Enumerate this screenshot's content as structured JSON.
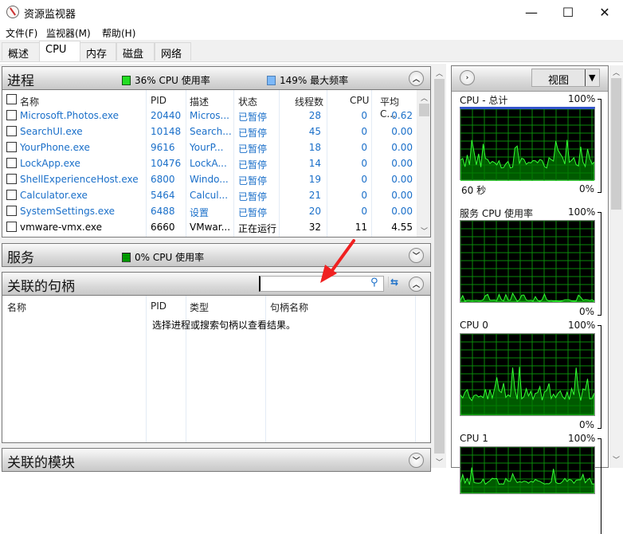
{
  "window": {
    "title": "资源监视器",
    "icon": "resource-monitor-icon",
    "controls": {
      "minimize": "—",
      "maximize": "☐",
      "close": "✕"
    }
  },
  "menu": [
    "文件(F)",
    "监视器(M)",
    "帮助(H)"
  ],
  "tabs": [
    {
      "label": "概述",
      "active": false
    },
    {
      "label": "CPU",
      "active": true
    },
    {
      "label": "内存",
      "active": false
    },
    {
      "label": "磁盘",
      "active": false
    },
    {
      "label": "网络",
      "active": false
    }
  ],
  "processes": {
    "title": "进程",
    "cpu_usage": "36% CPU 使用率",
    "max_freq": "149% 最大频率",
    "columns": [
      "名称",
      "PID",
      "描述",
      "状态",
      "线程数",
      "CPU",
      "平均 C..."
    ],
    "rows": [
      {
        "name": "Microsoft.Photos.exe",
        "pid": "20440",
        "desc": "Micros...",
        "status": "已暂停",
        "threads": "28",
        "cpu": "0",
        "avg": "0.62",
        "suspended": true
      },
      {
        "name": "SearchUI.exe",
        "pid": "10148",
        "desc": "Search...",
        "status": "已暂停",
        "threads": "45",
        "cpu": "0",
        "avg": "0.00",
        "suspended": true
      },
      {
        "name": "YourPhone.exe",
        "pid": "9616",
        "desc": "YourP...",
        "status": "已暂停",
        "threads": "18",
        "cpu": "0",
        "avg": "0.00",
        "suspended": true
      },
      {
        "name": "LockApp.exe",
        "pid": "10476",
        "desc": "LockA...",
        "status": "已暂停",
        "threads": "14",
        "cpu": "0",
        "avg": "0.00",
        "suspended": true
      },
      {
        "name": "ShellExperienceHost.exe",
        "pid": "6800",
        "desc": "Windo...",
        "status": "已暂停",
        "threads": "19",
        "cpu": "0",
        "avg": "0.00",
        "suspended": true
      },
      {
        "name": "Calculator.exe",
        "pid": "5464",
        "desc": "Calcul...",
        "status": "已暂停",
        "threads": "21",
        "cpu": "0",
        "avg": "0.00",
        "suspended": true
      },
      {
        "name": "SystemSettings.exe",
        "pid": "6488",
        "desc": "设置",
        "status": "已暂停",
        "threads": "20",
        "cpu": "0",
        "avg": "0.00",
        "suspended": true
      },
      {
        "name": "vmware-vmx.exe",
        "pid": "6660",
        "desc": "VMwar...",
        "status": "正在运行",
        "threads": "32",
        "cpu": "11",
        "avg": "4.55",
        "suspended": false
      }
    ]
  },
  "services": {
    "title": "服务",
    "cpu_usage": "0% CPU 使用率"
  },
  "handles": {
    "title": "关联的句柄",
    "search_value": "",
    "columns": [
      "名称",
      "PID",
      "类型",
      "句柄名称"
    ],
    "empty_message": "选择进程或搜索句柄以查看结果。"
  },
  "modules": {
    "title": "关联的模块"
  },
  "right_panel": {
    "view_label": "视图",
    "graphs": [
      {
        "label": "CPU - 总计",
        "max": "100%",
        "min": "0%",
        "time": "60 秒"
      },
      {
        "label": "服务 CPU 使用率",
        "max": "100%",
        "min": "0%"
      },
      {
        "label": "CPU 0",
        "max": "100%",
        "min": "0%"
      },
      {
        "label": "CPU 1",
        "max": "100%"
      }
    ]
  },
  "colors": {
    "link_blue": "#1a6fc9",
    "graph_line": "#33ff33",
    "graph_fill": "#006400",
    "annotation_red": "#f02020"
  }
}
